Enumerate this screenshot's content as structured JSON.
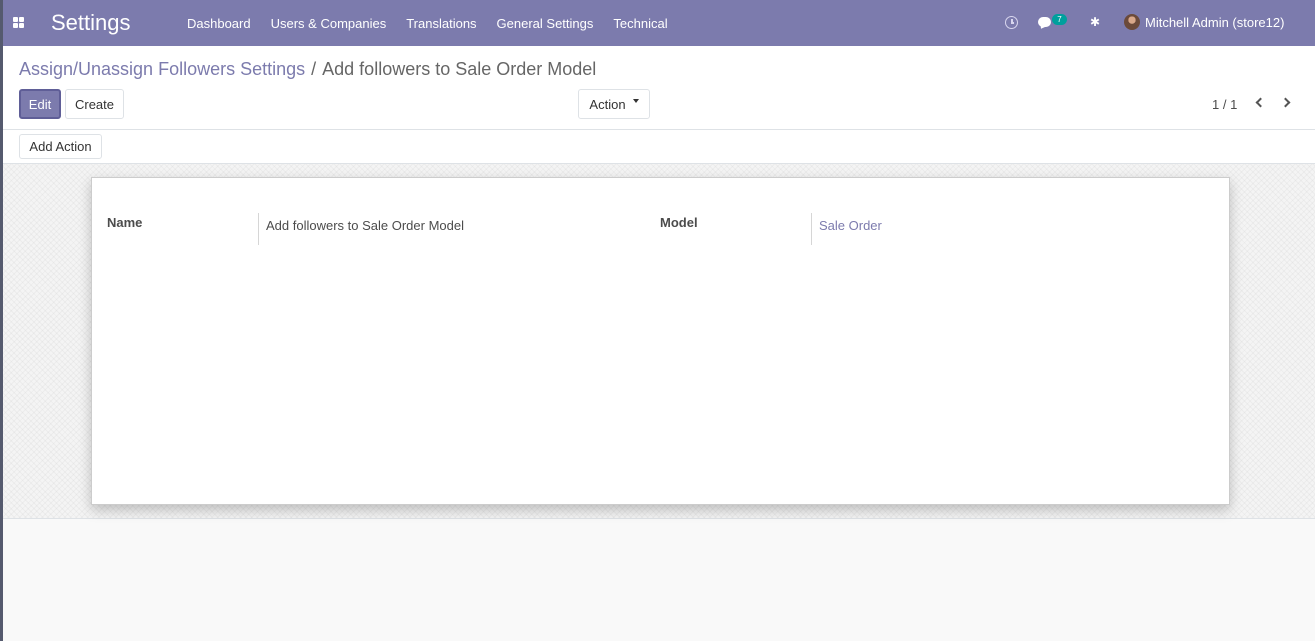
{
  "navbar": {
    "app_title": "Settings",
    "menu": [
      "Dashboard",
      "Users & Companies",
      "Translations",
      "General Settings",
      "Technical"
    ],
    "messages_count": "7",
    "user": "Mitchell Admin (store12)"
  },
  "control_panel": {
    "breadcrumb_parent": "Assign/Unassign Followers Settings",
    "breadcrumb_separator": "/",
    "breadcrumb_current": "Add followers to Sale Order Model",
    "edit_label": "Edit",
    "create_label": "Create",
    "action_label": "Action",
    "pager": "1 / 1"
  },
  "statusbar": {
    "add_action_label": "Add Action"
  },
  "form": {
    "name_label": "Name",
    "name_value": "Add followers to Sale Order Model",
    "model_label": "Model",
    "model_value": "Sale Order"
  },
  "colors": {
    "brand": "#7c7bad",
    "badge": "#00a09d"
  },
  "icons": [
    "apps-icon",
    "clock-icon",
    "chat-icon",
    "bug-icon",
    "avatar",
    "chevron-left-icon",
    "chevron-right-icon",
    "caret-down-icon"
  ]
}
